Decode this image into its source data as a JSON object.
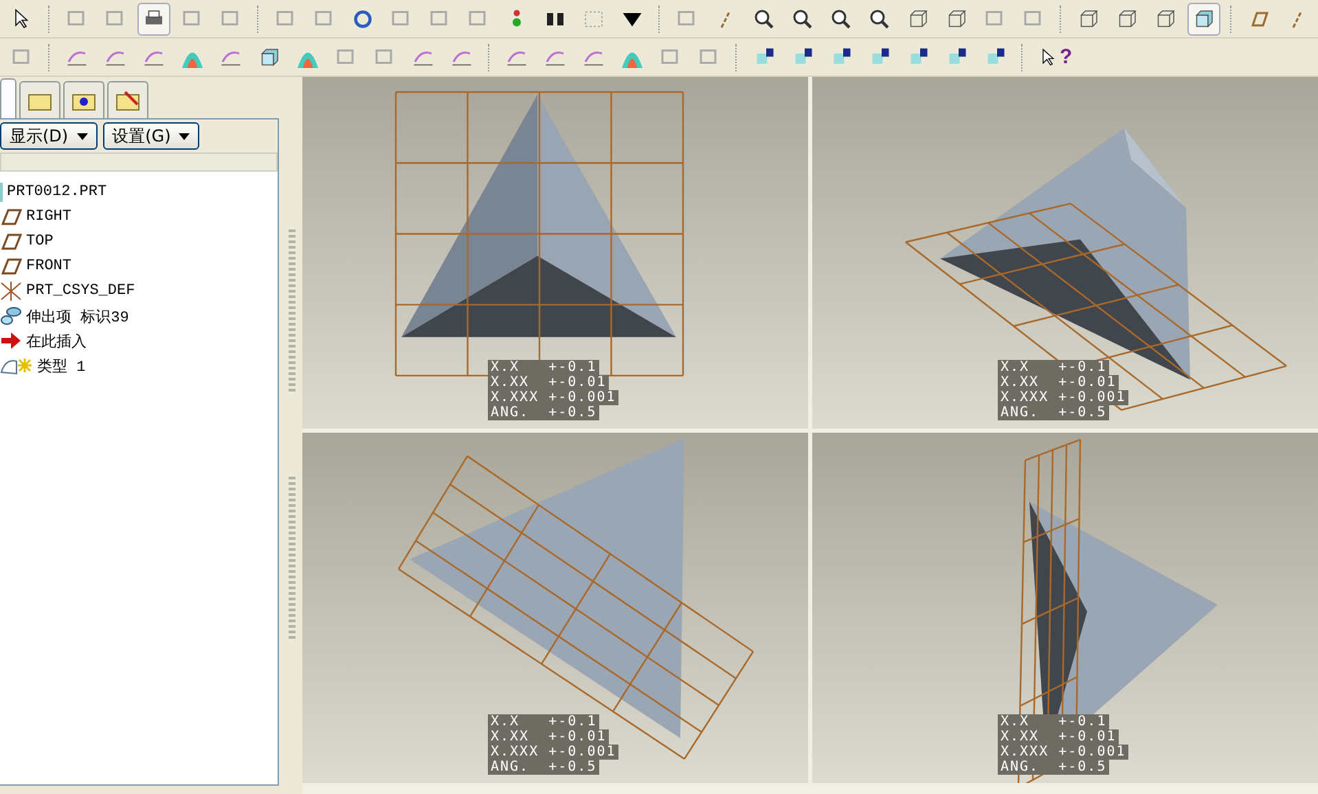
{
  "toolbar": {
    "help_mark": "?"
  },
  "model_tree": {
    "tabs": [
      {
        "selected": true
      },
      {
        "selected": false
      },
      {
        "selected": false
      },
      {
        "selected": false
      }
    ],
    "buttons": [
      "显示(D)",
      "设置(G)"
    ],
    "root": {
      "label": "PRT0012.PRT",
      "kind": "part",
      "children": [
        {
          "label": "RIGHT",
          "kind": "plane"
        },
        {
          "label": "TOP",
          "kind": "plane"
        },
        {
          "label": "FRONT",
          "kind": "plane"
        },
        {
          "label": "PRT_CSYS_DEF",
          "kind": "csys"
        },
        {
          "label": "伸出项 标识39",
          "kind": "extrude"
        },
        {
          "label": "在此插入",
          "kind": "insert"
        },
        {
          "label": "类型 1",
          "kind": "new"
        }
      ]
    }
  },
  "viewports": [
    {
      "tolerances": [
        "X.X   +-0.1",
        "X.XX  +-0.01",
        "X.XXX +-0.001",
        "ANG.  +-0.5"
      ]
    },
    {
      "tolerances": [
        "X.X   +-0.1",
        "X.XX  +-0.01",
        "X.XXX +-0.001",
        "ANG.  +-0.5"
      ]
    },
    {
      "tolerances": [
        "X.X   +-0.1",
        "X.XX  +-0.01",
        "X.XXX +-0.001",
        "ANG.  +-0.5"
      ]
    },
    {
      "tolerances": [
        "X.X   +-0.1",
        "X.XX  +-0.01",
        "X.XXX +-0.001",
        "ANG.  +-0.5"
      ]
    }
  ]
}
